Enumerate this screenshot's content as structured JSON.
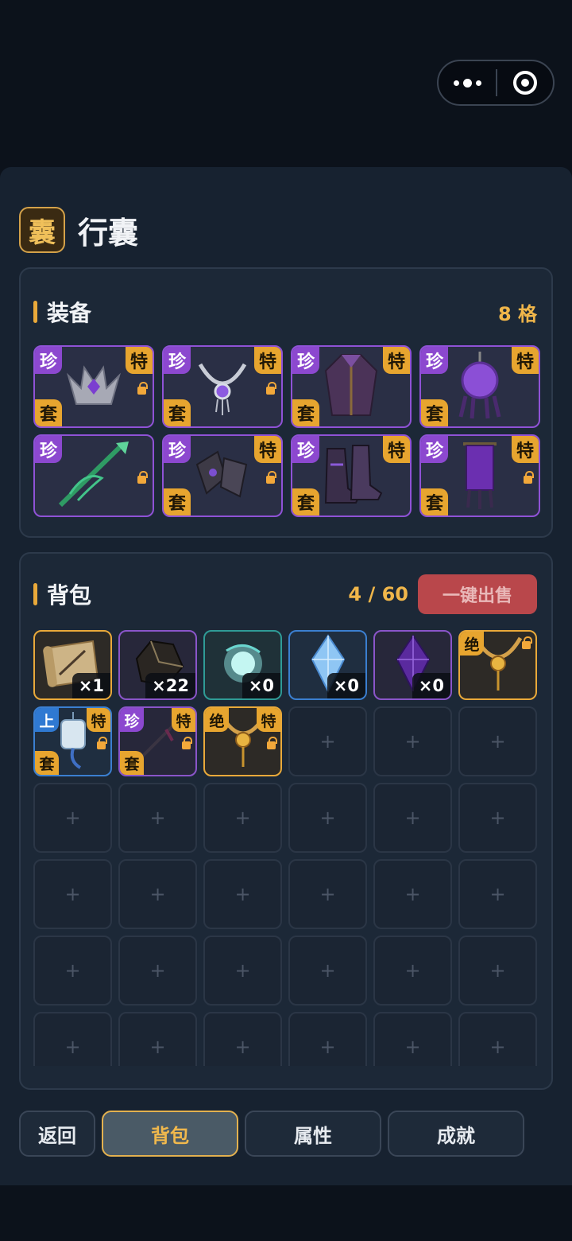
{
  "window": {
    "title_emblem": "囊",
    "title": "行囊"
  },
  "equipment": {
    "label": "装备",
    "count": "8 格",
    "slots": [
      {
        "badges": [
          "珍",
          "特",
          "套"
        ],
        "locked": true,
        "item": "crown-helm"
      },
      {
        "badges": [
          "珍",
          "特",
          "套"
        ],
        "locked": true,
        "item": "silver-necklace"
      },
      {
        "badges": [
          "珍",
          "特",
          "套"
        ],
        "locked": false,
        "item": "purple-robe"
      },
      {
        "badges": [
          "珍",
          "特",
          "套"
        ],
        "locked": false,
        "item": "purple-orb-pendant"
      },
      {
        "badges": [
          "珍"
        ],
        "locked": true,
        "item": "jade-spear"
      },
      {
        "badges": [
          "珍",
          "特",
          "套"
        ],
        "locked": true,
        "item": "gauntlets"
      },
      {
        "badges": [
          "珍",
          "特",
          "套"
        ],
        "locked": false,
        "item": "boots"
      },
      {
        "badges": [
          "珍",
          "特",
          "套"
        ],
        "locked": true,
        "item": "purple-banner"
      }
    ]
  },
  "bag": {
    "label": "背包",
    "count": "4 / 60",
    "sell_label": "一键出售",
    "empty_glyph": "+",
    "items": [
      {
        "quality": "gold",
        "qty": "×1",
        "item": "scroll"
      },
      {
        "quality": "purple",
        "qty": "×22",
        "item": "ore"
      },
      {
        "quality": "teal",
        "qty": "×0",
        "item": "spirit-orb"
      },
      {
        "quality": "blue",
        "qty": "×0",
        "item": "blue-crystal"
      },
      {
        "quality": "purple",
        "qty": "×0",
        "item": "purple-crystal"
      },
      {
        "quality": "gold",
        "badge_tl": "绝",
        "locked": true,
        "item": "gold-necklace"
      },
      {
        "quality": "blue",
        "badge_tl": "上",
        "badge_tr": "特",
        "badge_bl": "套",
        "locked": true,
        "item": "jade-pendant"
      },
      {
        "quality": "purple",
        "badge_tl": "珍",
        "badge_tr": "特",
        "badge_bl": "套",
        "locked": true,
        "item": "dark-spear"
      },
      {
        "quality": "gold",
        "badge_tl": "绝",
        "badge_tr": "特",
        "locked": true,
        "item": "gold-necklace"
      }
    ]
  },
  "tabs": [
    "返回",
    "背包",
    "属性",
    "成就"
  ],
  "colors": {
    "accent": "#e9a93a",
    "rare_purple": "#8c48cf",
    "sell_red": "#b9474b"
  }
}
